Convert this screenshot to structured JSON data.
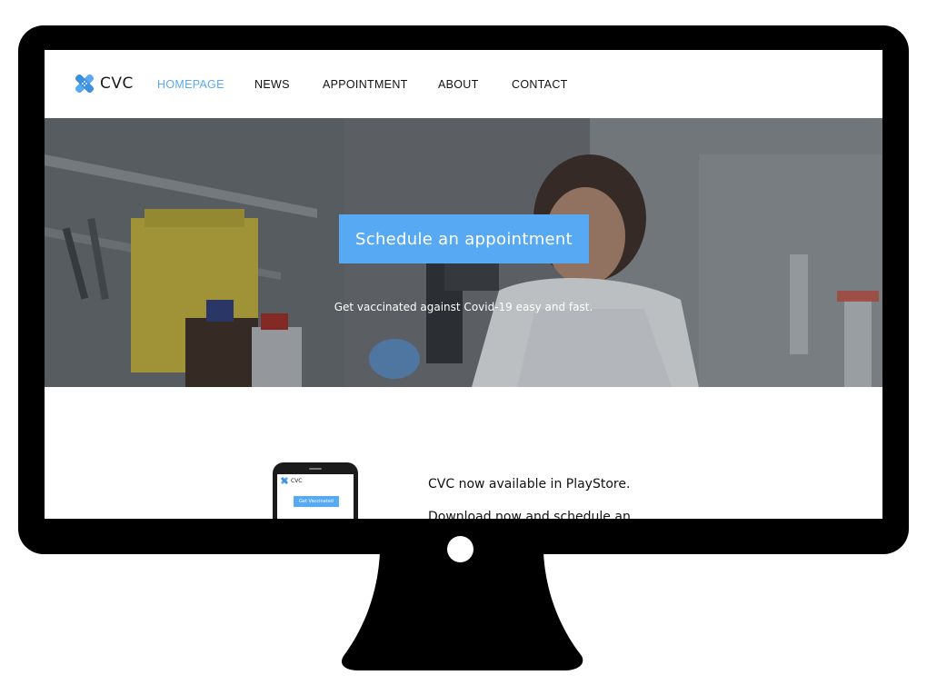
{
  "brand": {
    "name": "CVC",
    "accent_color": "#58a9f3",
    "logo_icon": "bandage-cross-icon"
  },
  "nav": {
    "items": [
      {
        "label": "HOMEPAGE",
        "active": true
      },
      {
        "label": "NEWS",
        "active": false
      },
      {
        "label": "APPOINTMENT",
        "active": false
      },
      {
        "label": "ABOUT",
        "active": false
      },
      {
        "label": "CONTACT",
        "active": false
      }
    ]
  },
  "hero": {
    "cta_label": "Schedule an appointment",
    "subtitle": "Get vaccinated against Covid-19 easy and fast.",
    "background": "lab-scientist-photo"
  },
  "promo": {
    "title": "CVC now available in PlayStore.",
    "body": "Download now and schedule an",
    "phone": {
      "brand": "CVC",
      "button_label": "Get Vaccinated"
    }
  }
}
